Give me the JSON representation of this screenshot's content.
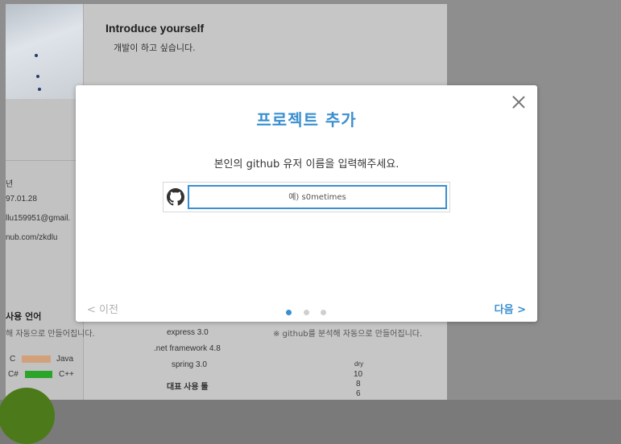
{
  "background": {
    "intro_title": "Introduce yourself",
    "intro_text": "개발이 하고 싶습니다.",
    "info": {
      "name_fragment": "년",
      "birth": "97.01.28",
      "email": "llu159951@gmail.",
      "github": "nub.com/zkdlu"
    },
    "lang_title": "사용 언어",
    "auto_note_left": "해 자동으로 만들어집니다.",
    "auto_note_right": "※ github를 분석해 자동으로 만들어집니다.",
    "languages": [
      {
        "name": "C",
        "color": "#d2a07a"
      },
      {
        "name": "Java",
        "color": "#d2a07a"
      },
      {
        "name": "C#",
        "color": "#2aa52a"
      },
      {
        "name": "C++",
        "color": "#2aa52a"
      }
    ],
    "frameworks": [
      "express 3.0",
      ".net framework 4.8",
      "spring 3.0"
    ],
    "tools_title": "대표 사용 툴",
    "radar": {
      "label": "dry",
      "ticks": [
        "10",
        "8",
        "6"
      ]
    }
  },
  "modal": {
    "title": "프로젝트 추가",
    "subtitle": "본인의 github 유저 이름을 입력해주세요.",
    "input_placeholder": "예) s0metimes",
    "input_value": "",
    "prev_label": "< 이전",
    "next_label": "다음 >",
    "step_current": 1,
    "step_total": 3,
    "close_icon": "close-icon",
    "github_icon": "github-icon"
  },
  "colors": {
    "accent": "#3a8fd0",
    "disabled": "#b0b0b0"
  }
}
